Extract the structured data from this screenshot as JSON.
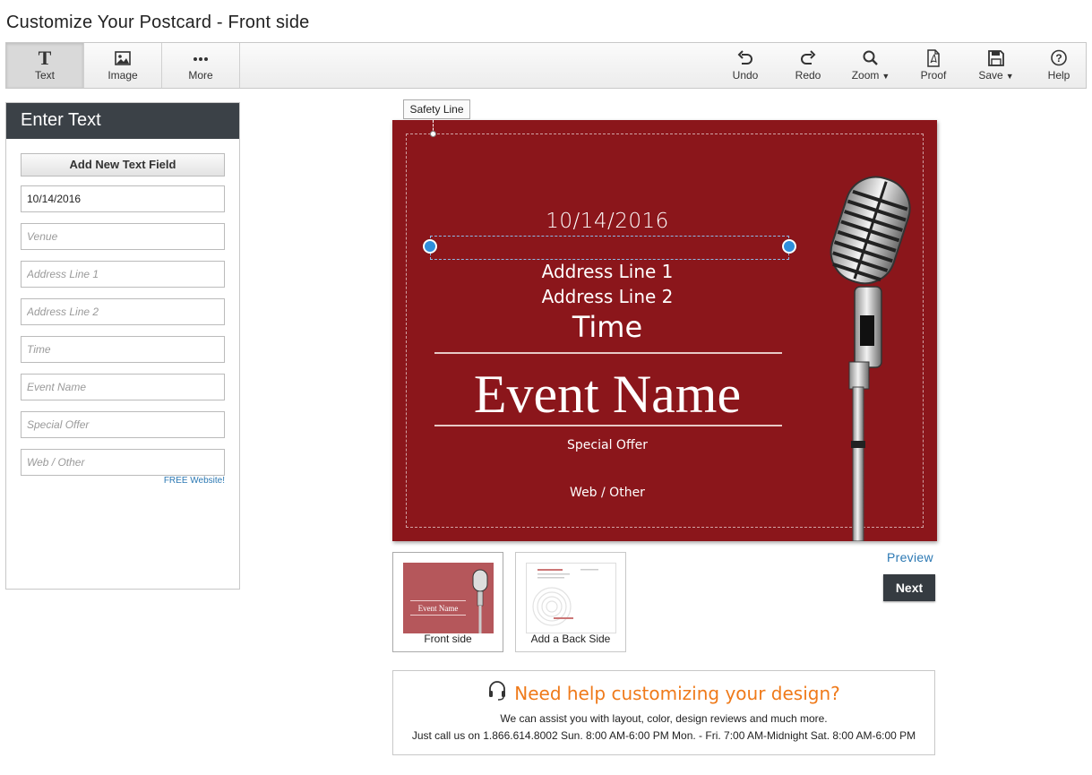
{
  "page": {
    "title": "Customize Your Postcard - Front side"
  },
  "toolbar": {
    "left": [
      {
        "id": "text",
        "label": "Text",
        "icon": "text-icon",
        "active": true
      },
      {
        "id": "image",
        "label": "Image",
        "icon": "image-icon",
        "active": false
      },
      {
        "id": "more",
        "label": "More",
        "icon": "more-icon",
        "active": false
      }
    ],
    "right": [
      {
        "id": "undo",
        "label": "Undo",
        "icon": "undo-icon"
      },
      {
        "id": "redo",
        "label": "Redo",
        "icon": "redo-icon"
      },
      {
        "id": "zoom",
        "label": "Zoom",
        "icon": "zoom-icon",
        "dropdown": true
      },
      {
        "id": "proof",
        "label": "Proof",
        "icon": "pdf-icon"
      },
      {
        "id": "save",
        "label": "Save",
        "icon": "save-icon",
        "dropdown": true
      },
      {
        "id": "help",
        "label": "Help",
        "icon": "help-icon"
      }
    ]
  },
  "panel": {
    "title": "Enter Text",
    "add_button": "Add New Text Field",
    "fields": [
      {
        "value": "10/14/2016",
        "placeholder": ""
      },
      {
        "value": "",
        "placeholder": "Venue"
      },
      {
        "value": "",
        "placeholder": "Address Line 1"
      },
      {
        "value": "",
        "placeholder": "Address Line 2"
      },
      {
        "value": "",
        "placeholder": "Time"
      },
      {
        "value": "",
        "placeholder": "Event Name"
      },
      {
        "value": "",
        "placeholder": "Special Offer"
      },
      {
        "value": "",
        "placeholder": "Web / Other"
      }
    ],
    "free_website": "FREE Website!"
  },
  "canvas": {
    "safety_line_button": "Safety Line",
    "card": {
      "background": "#8b161b",
      "date": "10/14/2016",
      "address1": "Address Line 1",
      "address2": "Address Line 2",
      "time": "Time",
      "event_name": "Event Name",
      "special_offer": "Special Offer",
      "web": "Web / Other"
    }
  },
  "thumbnails": {
    "front": {
      "label": "Front side",
      "event_name": "Event Name"
    },
    "back": {
      "label": "Add a Back Side"
    }
  },
  "actions": {
    "preview": "Preview",
    "next": "Next"
  },
  "help": {
    "title": "Need help customizing your design?",
    "line1": "We can assist you with layout, color, design reviews and much more.",
    "line2": "Just call us on 1.866.614.8002 Sun. 8:00 AM-6:00 PM Mon. - Fri. 7:00 AM-Midnight Sat. 8:00 AM-6:00 PM",
    "accent": "#ef7a1a"
  }
}
